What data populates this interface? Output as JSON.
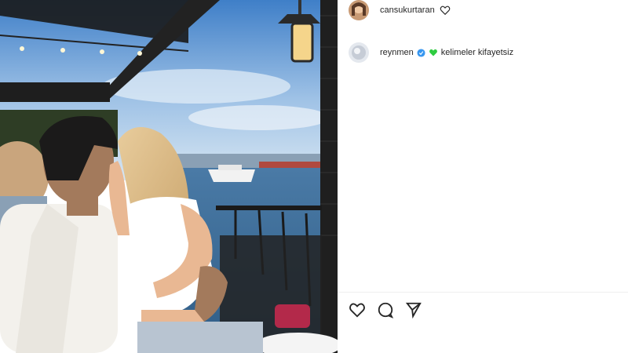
{
  "post_author": {
    "username": "cansukurtaran"
  },
  "comment": {
    "username": "reynmen",
    "text": "kelimeler kifayetsiz"
  },
  "icons": {
    "like": "heart-icon",
    "comment": "comment-icon",
    "share": "share-icon",
    "verified": "verified-badge-icon",
    "emoji": "green-heart-icon"
  },
  "colors": {
    "verified": "#3897f0",
    "green_heart": "#2ecc40",
    "text": "#262626"
  }
}
